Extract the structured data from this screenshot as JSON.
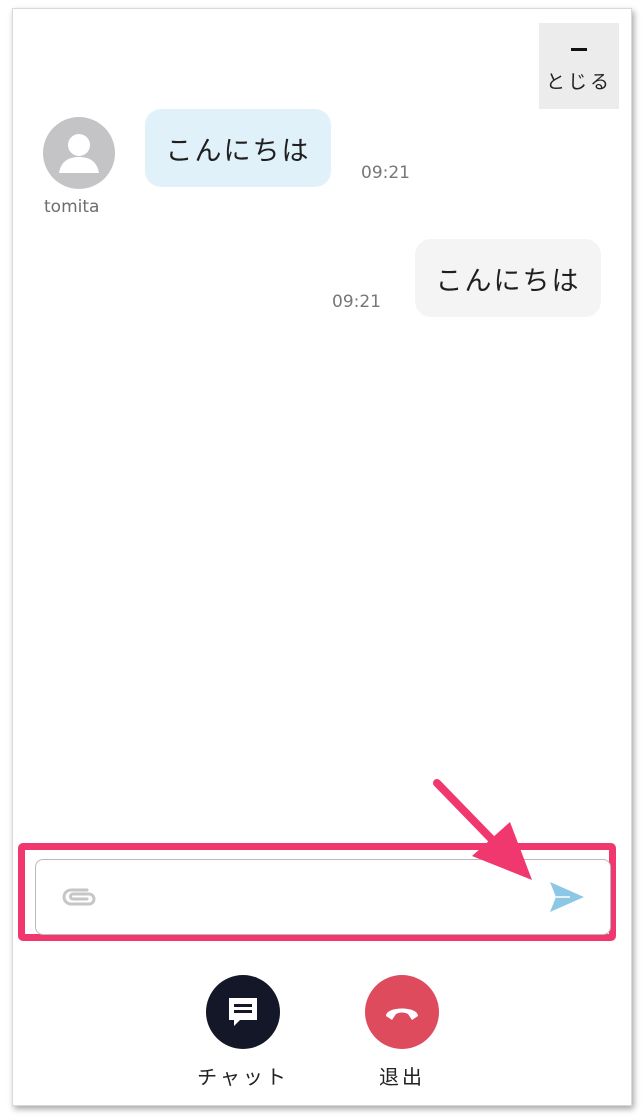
{
  "header": {
    "close_label": "とじる"
  },
  "messages": [
    {
      "sender": "tomita",
      "text": "こんにちは",
      "time": "09:21",
      "direction": "incoming"
    },
    {
      "text": "こんにちは",
      "time": "09:21",
      "direction": "outgoing"
    }
  ],
  "composer": {
    "value": "",
    "placeholder": "",
    "icons": {
      "attach": "paperclip-icon",
      "send": "send-icon"
    }
  },
  "bottom_bar": {
    "chat_label": "チャット",
    "exit_label": "退出",
    "icons": {
      "chat": "chat-icon",
      "exit": "hang-up-icon"
    }
  },
  "colors": {
    "incoming_bubble": "#e1f1fa",
    "outgoing_bubble": "#f4f4f4",
    "highlight": "#f0386f",
    "send_icon": "#8cc8e6",
    "chat_button": "#141728",
    "exit_button": "#dd4b5d"
  }
}
